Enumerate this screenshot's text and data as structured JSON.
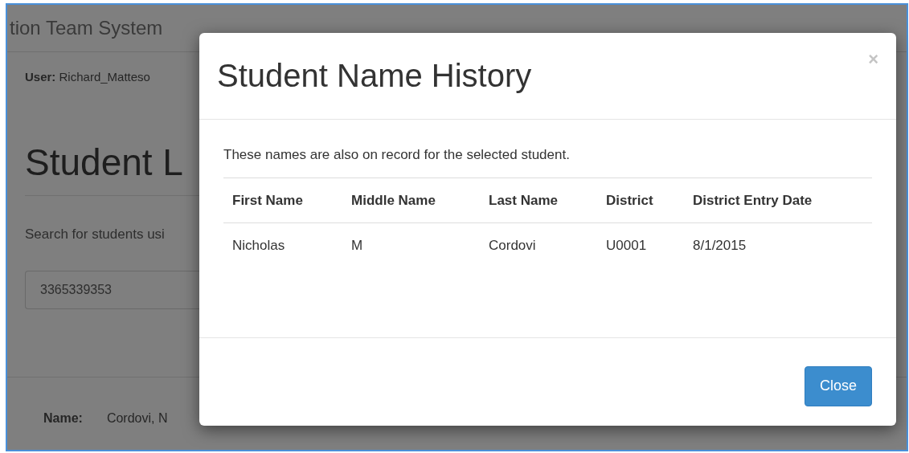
{
  "background_page": {
    "app_title": "tion Team System",
    "user_label": "User:",
    "user_name": "Richard_Matteso",
    "heading": "Student L",
    "search_hint": "Search for students usi",
    "search_field": {
      "value": "3365339353"
    },
    "name_label": "Name:",
    "name_value": "Cordovi, N"
  },
  "modal": {
    "title": "Student Name History",
    "close_symbol": "×",
    "message": "These names are also on record for the selected student.",
    "table": {
      "columns": [
        "First Name",
        "Middle Name",
        "Last Name",
        "District",
        "District Entry Date"
      ],
      "rows": [
        [
          "Nicholas",
          "M",
          "Cordovi",
          "U0001",
          "8/1/2015"
        ]
      ]
    },
    "buttons": [
      "Close"
    ]
  }
}
